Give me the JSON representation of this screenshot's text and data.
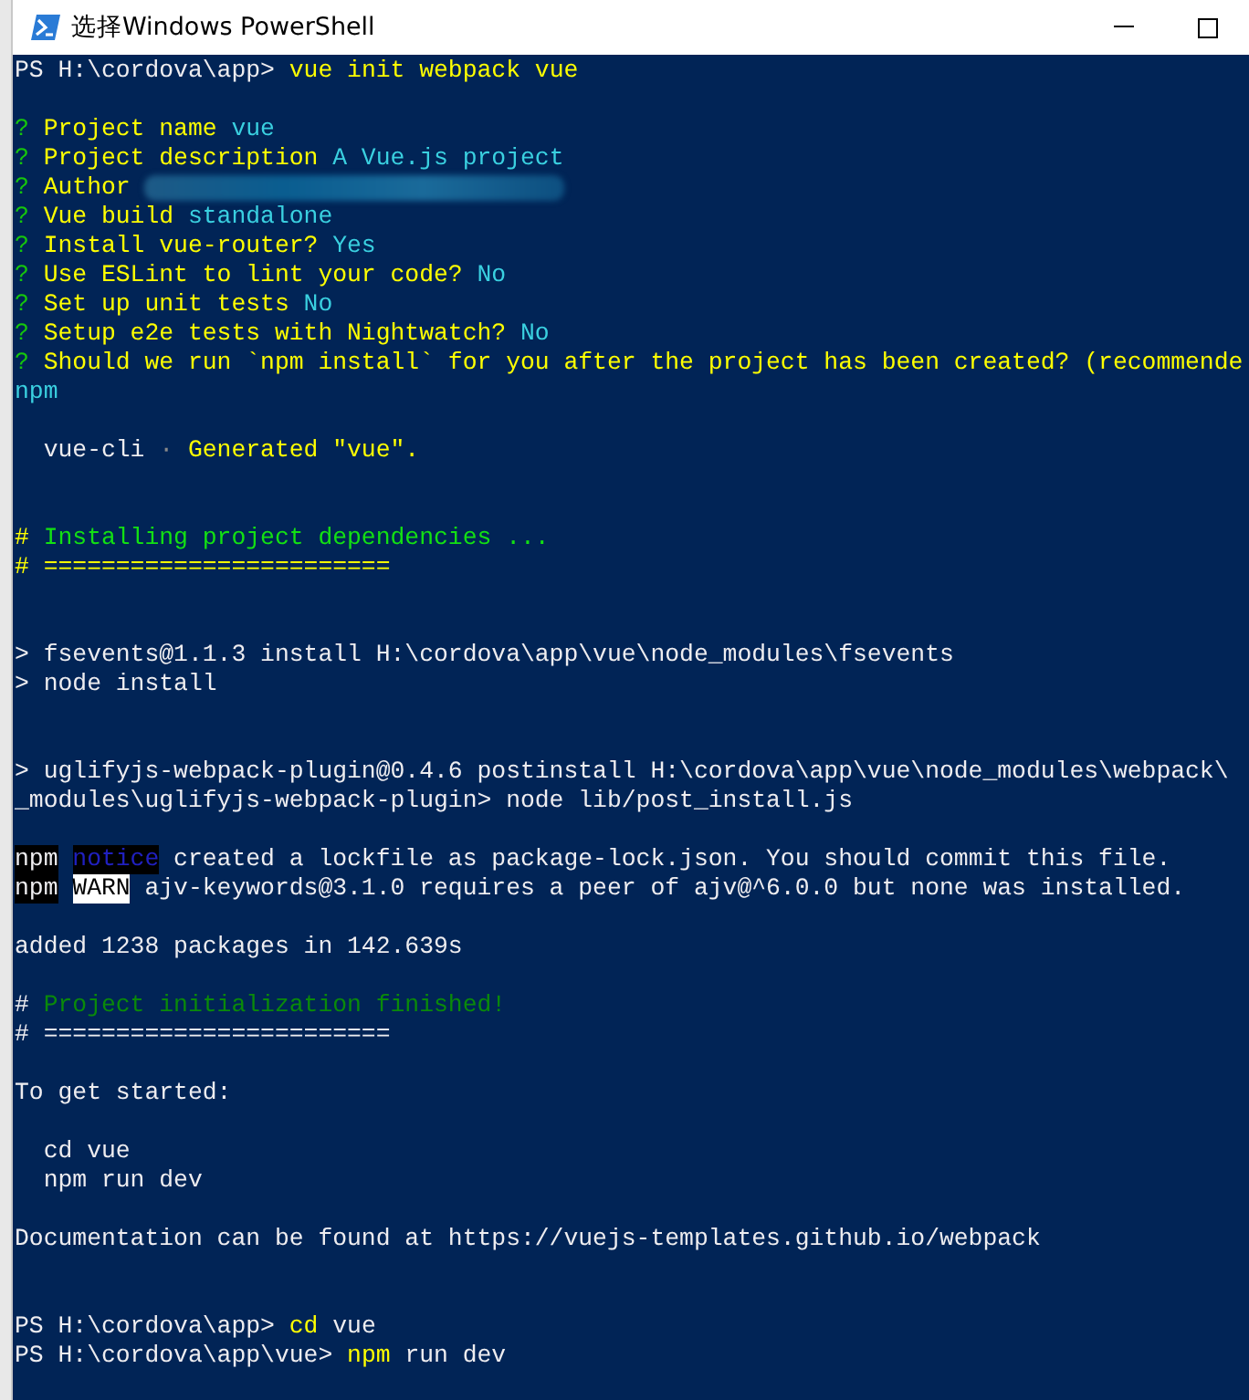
{
  "window": {
    "title": "选择Windows PowerShell"
  },
  "lines": [
    {
      "segments": [
        {
          "text": "PS H:\\cordova\\app> ",
          "color": "#eeedf0"
        },
        {
          "text": "vue init webpack vue",
          "color": "#ffff00"
        }
      ]
    },
    {
      "kind": "blank"
    },
    {
      "segments": [
        {
          "text": "? ",
          "color": "#16c60c"
        },
        {
          "text": "Project name ",
          "color": "#ffff00"
        },
        {
          "text": "vue",
          "color": "#3ad0e0"
        }
      ]
    },
    {
      "segments": [
        {
          "text": "? ",
          "color": "#16c60c"
        },
        {
          "text": "Project description ",
          "color": "#ffff00"
        },
        {
          "text": "A Vue.js project",
          "color": "#3ad0e0"
        }
      ]
    },
    {
      "segments": [
        {
          "text": "? ",
          "color": "#16c60c"
        },
        {
          "text": "Author",
          "color": "#ffff00"
        }
      ],
      "redacted": true
    },
    {
      "segments": [
        {
          "text": "? ",
          "color": "#16c60c"
        },
        {
          "text": "Vue build ",
          "color": "#ffff00"
        },
        {
          "text": "standalone",
          "color": "#3ad0e0"
        }
      ]
    },
    {
      "segments": [
        {
          "text": "? ",
          "color": "#16c60c"
        },
        {
          "text": "Install vue-router? ",
          "color": "#ffff00"
        },
        {
          "text": "Yes",
          "color": "#3ad0e0"
        }
      ]
    },
    {
      "segments": [
        {
          "text": "? ",
          "color": "#16c60c"
        },
        {
          "text": "Use ESLint to lint your code? ",
          "color": "#ffff00"
        },
        {
          "text": "No",
          "color": "#3ad0e0"
        }
      ]
    },
    {
      "segments": [
        {
          "text": "? ",
          "color": "#16c60c"
        },
        {
          "text": "Set up unit tests ",
          "color": "#ffff00"
        },
        {
          "text": "No",
          "color": "#3ad0e0"
        }
      ]
    },
    {
      "segments": [
        {
          "text": "? ",
          "color": "#16c60c"
        },
        {
          "text": "Setup e2e tests with Nightwatch? ",
          "color": "#ffff00"
        },
        {
          "text": "No",
          "color": "#3ad0e0"
        }
      ]
    },
    {
      "segments": [
        {
          "text": "? ",
          "color": "#16c60c"
        },
        {
          "text": "Should we run `npm install` for you after the project has been created? (recommende",
          "color": "#ffff00"
        }
      ]
    },
    {
      "segments": [
        {
          "text": "npm",
          "color": "#3ad0e0"
        }
      ]
    },
    {
      "kind": "blank"
    },
    {
      "segments": [
        {
          "text": "  vue-cli ",
          "color": "#eeedf0"
        },
        {
          "text": "· ",
          "color": "#8a8a8a"
        },
        {
          "text": "Generated \"vue\".",
          "color": "#ffff00"
        }
      ]
    },
    {
      "kind": "blank"
    },
    {
      "kind": "blank"
    },
    {
      "segments": [
        {
          "text": "# ",
          "color": "#ffff00"
        },
        {
          "text": "Installing project dependencies ...",
          "color": "#13e013"
        }
      ]
    },
    {
      "segments": [
        {
          "text": "# ========================",
          "color": "#ffff00"
        }
      ]
    },
    {
      "kind": "blank"
    },
    {
      "kind": "blank"
    },
    {
      "segments": [
        {
          "text": "> fsevents@1.1.3 install H:\\cordova\\app\\vue\\node_modules\\fsevents",
          "color": "#eeedf0"
        }
      ]
    },
    {
      "segments": [
        {
          "text": "> node install",
          "color": "#eeedf0"
        }
      ]
    },
    {
      "kind": "blank"
    },
    {
      "kind": "blank"
    },
    {
      "segments": [
        {
          "text": "> uglifyjs-webpack-plugin@0.4.6 postinstall H:\\cordova\\app\\vue\\node_modules\\webpack\\",
          "color": "#eeedf0"
        }
      ]
    },
    {
      "segments": [
        {
          "text": "_modules\\uglifyjs-webpack-plugin> node lib/post_install.js",
          "color": "#eeedf0"
        }
      ]
    },
    {
      "kind": "blank"
    },
    {
      "segments": [
        {
          "text": "npm",
          "kind": "dark"
        },
        {
          "text": "notice",
          "kind": "notice"
        },
        {
          "text": " created a lockfile as package-lock.json. You should commit this file.",
          "color": "#eeedf0"
        }
      ]
    },
    {
      "segments": [
        {
          "text": "npm",
          "kind": "dark"
        },
        {
          "text": "WARN",
          "kind": "light"
        },
        {
          "text": " ajv-keywords@3.1.0 requires a peer of ajv@^6.0.0 but none was installed.",
          "color": "#eeedf0"
        }
      ]
    },
    {
      "kind": "blank"
    },
    {
      "segments": [
        {
          "text": "added 1238 packages in 142.639s",
          "color": "#eeedf0"
        }
      ]
    },
    {
      "kind": "blank"
    },
    {
      "segments": [
        {
          "text": "# ",
          "color": "#eeedf0"
        },
        {
          "text": "Project initialization finished!",
          "color": "#0a8a0a"
        }
      ]
    },
    {
      "segments": [
        {
          "text": "# ========================",
          "color": "#eeedf0"
        }
      ]
    },
    {
      "kind": "blank"
    },
    {
      "segments": [
        {
          "text": "To get started:",
          "color": "#eeedf0"
        }
      ]
    },
    {
      "kind": "blank"
    },
    {
      "segments": [
        {
          "text": "  cd vue",
          "color": "#eeedf0"
        }
      ]
    },
    {
      "segments": [
        {
          "text": "  npm run dev",
          "color": "#eeedf0"
        }
      ]
    },
    {
      "kind": "blank"
    },
    {
      "segments": [
        {
          "text": "Documentation can be found at https://vuejs-templates.github.io/webpack",
          "color": "#eeedf0"
        }
      ]
    },
    {
      "kind": "blank"
    },
    {
      "kind": "blank"
    },
    {
      "segments": [
        {
          "text": "PS H:\\cordova\\app> ",
          "color": "#eeedf0"
        },
        {
          "text": "cd",
          "color": "#ffff00"
        },
        {
          "text": " vue",
          "color": "#eeedf0"
        }
      ]
    },
    {
      "segments": [
        {
          "text": "PS H:\\cordova\\app\\vue> ",
          "color": "#eeedf0"
        },
        {
          "text": "npm",
          "color": "#ffff00"
        },
        {
          "text": " run dev",
          "color": "#eeedf0"
        }
      ]
    }
  ]
}
